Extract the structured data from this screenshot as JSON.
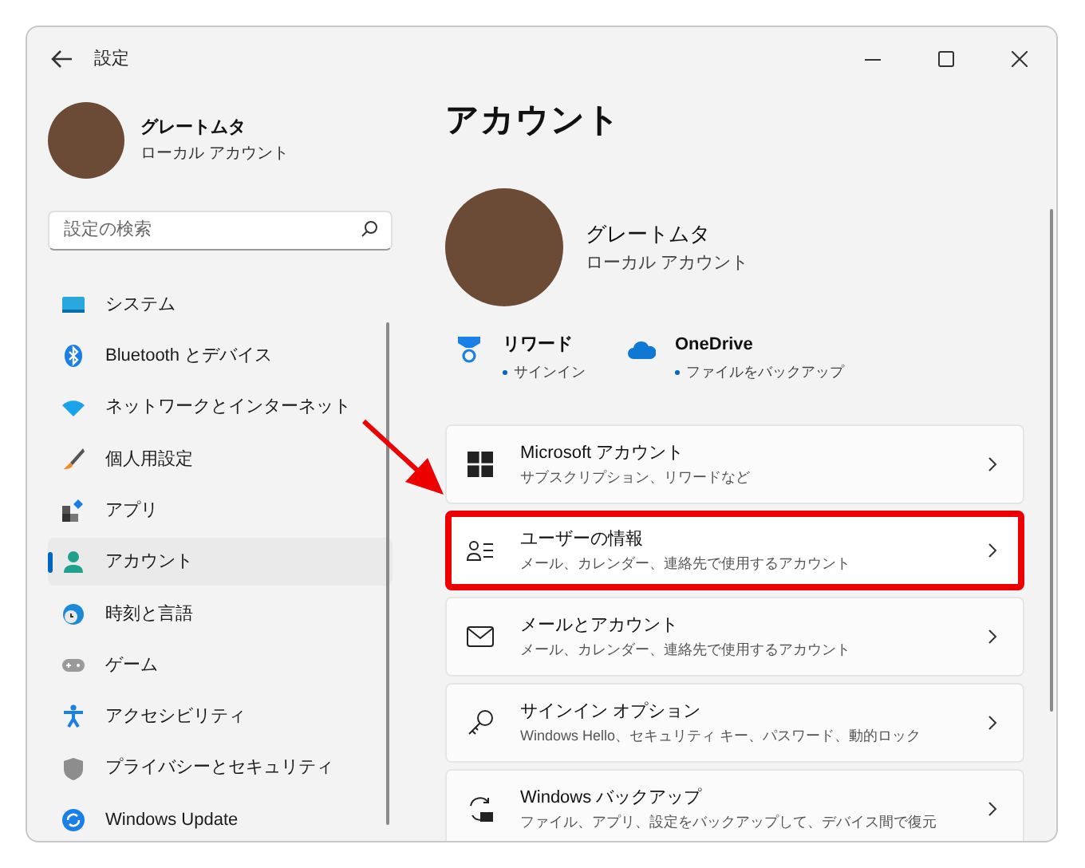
{
  "window": {
    "title": "設定"
  },
  "sidebar": {
    "profile": {
      "name": "グレートムタ",
      "account_type": "ローカル アカウント"
    },
    "search": {
      "placeholder": "設定の検索"
    },
    "items": [
      {
        "label": "システム",
        "selected": false
      },
      {
        "label": "Bluetooth とデバイス",
        "selected": false
      },
      {
        "label": "ネットワークとインターネット",
        "selected": false
      },
      {
        "label": "個人用設定",
        "selected": false
      },
      {
        "label": "アプリ",
        "selected": false
      },
      {
        "label": "アカウント",
        "selected": true
      },
      {
        "label": "時刻と言語",
        "selected": false
      },
      {
        "label": "ゲーム",
        "selected": false
      },
      {
        "label": "アクセシビリティ",
        "selected": false
      },
      {
        "label": "プライバシーとセキュリティ",
        "selected": false
      },
      {
        "label": "Windows Update",
        "selected": false
      }
    ]
  },
  "page": {
    "title": "アカウント",
    "profile": {
      "name": "グレートムタ",
      "account_type": "ローカル アカウント"
    },
    "services": [
      {
        "title": "リワード",
        "status": "サインイン"
      },
      {
        "title": "OneDrive",
        "status": "ファイルをバックアップ"
      }
    ],
    "cards": [
      {
        "title": "Microsoft アカウント",
        "subtitle": "サブスクリプション、リワードなど",
        "highlighted": false
      },
      {
        "title": "ユーザーの情報",
        "subtitle": "メール、カレンダー、連絡先で使用するアカウント",
        "highlighted": true
      },
      {
        "title": "メールとアカウント",
        "subtitle": "メール、カレンダー、連絡先で使用するアカウント",
        "highlighted": false
      },
      {
        "title": "サインイン オプション",
        "subtitle": "Windows Hello、セキュリティ キー、パスワード、動的ロック",
        "highlighted": false
      },
      {
        "title": "Windows バックアップ",
        "subtitle": "ファイル、アプリ、設定をバックアップして、デバイス間で復元",
        "highlighted": false
      }
    ]
  }
}
